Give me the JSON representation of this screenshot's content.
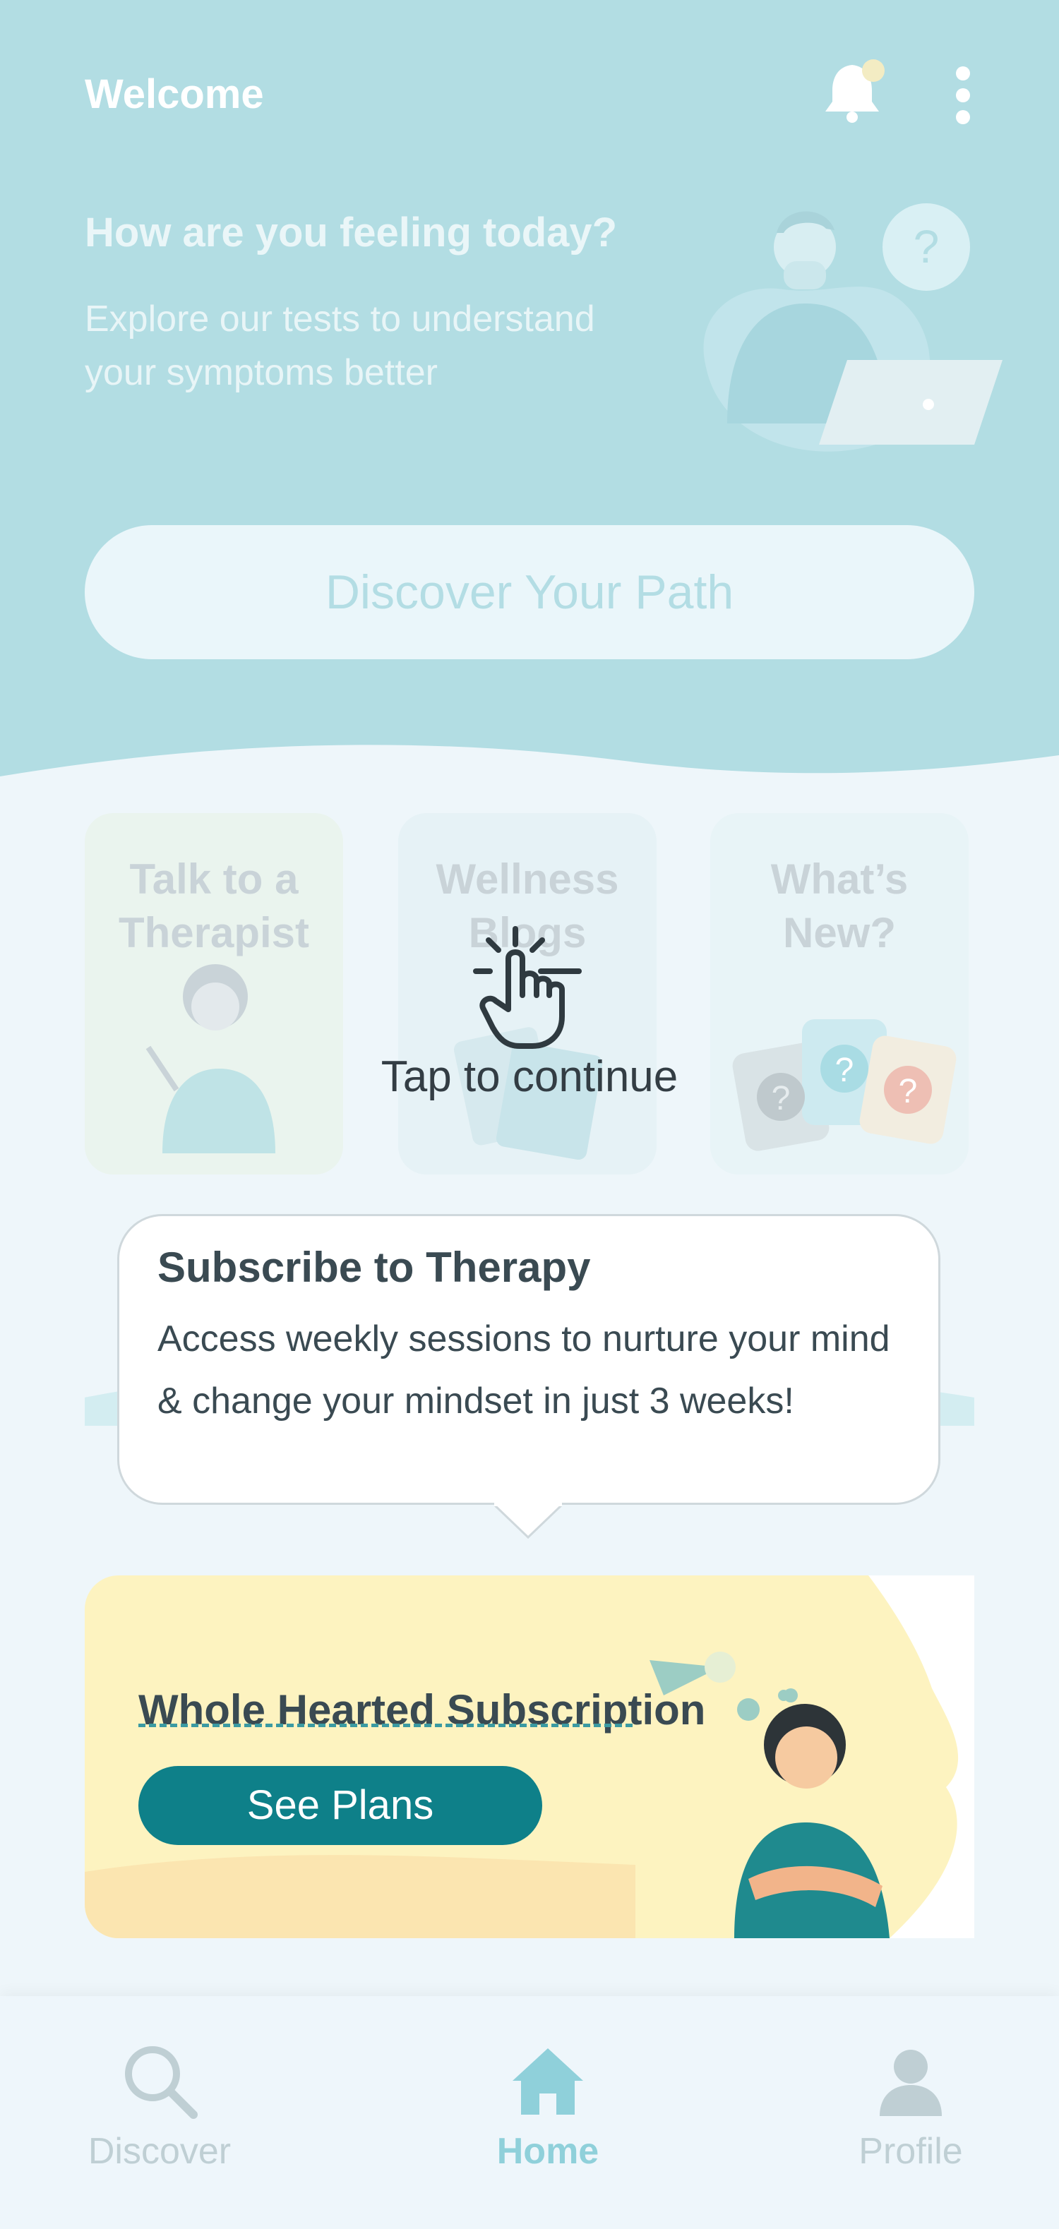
{
  "header": {
    "title": "Welcome",
    "question": "How are you feeling today?",
    "subtitle": "Explore our tests to understand your symptoms better",
    "illustration_badge": "?"
  },
  "primary_button": {
    "label": "Discover Your Path"
  },
  "cards": [
    {
      "label": "Talk to a Therapist",
      "icon": "therapist-illustration"
    },
    {
      "label": "Wellness Blogs",
      "icon": "blogs-illustration"
    },
    {
      "label": "What’s New?",
      "icon": "question-cards-illustration"
    }
  ],
  "overlay": {
    "tap_text": "Tap to continue",
    "icon": "tap-hand-icon"
  },
  "tooltip": {
    "title": "Subscribe to Therapy",
    "body": "Access weekly sessions to nurture your mind & change your mindset in just 3 weeks!"
  },
  "promo": {
    "title": "Whole Hearted Subscription",
    "button_label": "See Plans"
  },
  "bottom_nav": [
    {
      "label": "Discover",
      "icon": "search-icon",
      "active": false
    },
    {
      "label": "Home",
      "icon": "home-icon",
      "active": true
    },
    {
      "label": "Profile",
      "icon": "profile-icon",
      "active": false
    }
  ],
  "colors": {
    "header_bg": "#b2dde3",
    "page_bg": "#eef6fa",
    "accent": "#0e8089",
    "promo_bg": "#fdf3c0",
    "nav_active": "#8fd0da",
    "nav_inactive": "#bfcfd4"
  }
}
